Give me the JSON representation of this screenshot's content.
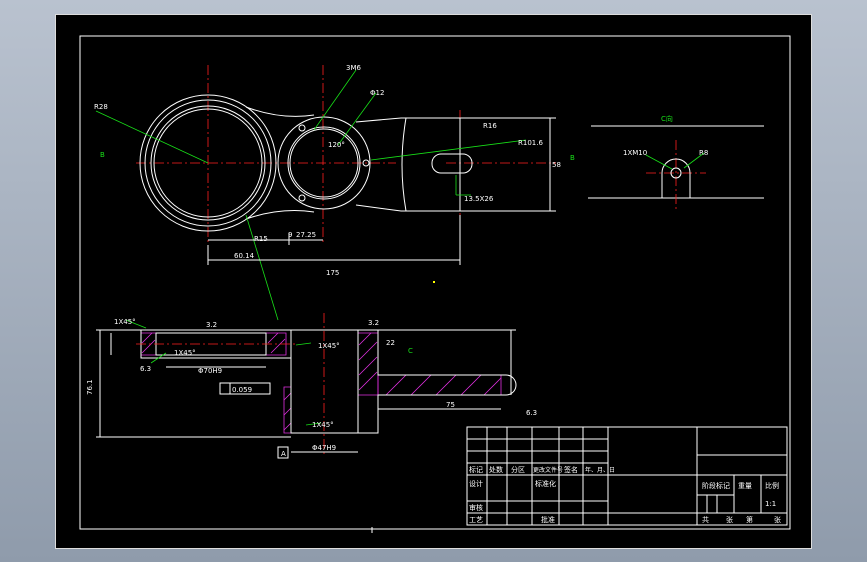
{
  "drawing": {
    "top_view": {
      "section_marks": [
        "B",
        "B"
      ],
      "view_label": "C向",
      "dims": {
        "thread": "3M6",
        "phi12": "Φ12",
        "r28": "R28",
        "r16": "R16",
        "r101": "R101.6",
        "slot": "13.5X26",
        "d9": "9",
        "d2725": "27.25",
        "d6014": "60.14",
        "d175": "175",
        "h58": "58",
        "angle": "120°",
        "r15": "R15"
      }
    },
    "c_view": {
      "label": "C向",
      "m10": "1XM10",
      "r8": "R8"
    },
    "section_view": {
      "label": "C",
      "chamfer1": "1X45°",
      "chamfer2": "1X45°",
      "chamfer3": "1X45°",
      "chamfer4": "1X45°",
      "phi_bore": "Φ70H9",
      "phi_bore2": "Φ47H9",
      "tol_box": "0.059",
      "datum": "A",
      "d75": "75",
      "d76": "76.1",
      "d22": "22",
      "v1": "3.2",
      "v2": "3.2",
      "v3": "6.3",
      "v4": "6.3",
      "ra": "Ra"
    },
    "title_block": {
      "labels": [
        "标记",
        "处数",
        "分区",
        "更改文件号",
        "签名",
        "年、月、日",
        "设计",
        "标准化",
        "审核",
        "工艺",
        "批准",
        "阶段标记",
        "重量",
        "比例",
        "共",
        "张",
        "第",
        "张"
      ],
      "scale": "1:1"
    }
  }
}
